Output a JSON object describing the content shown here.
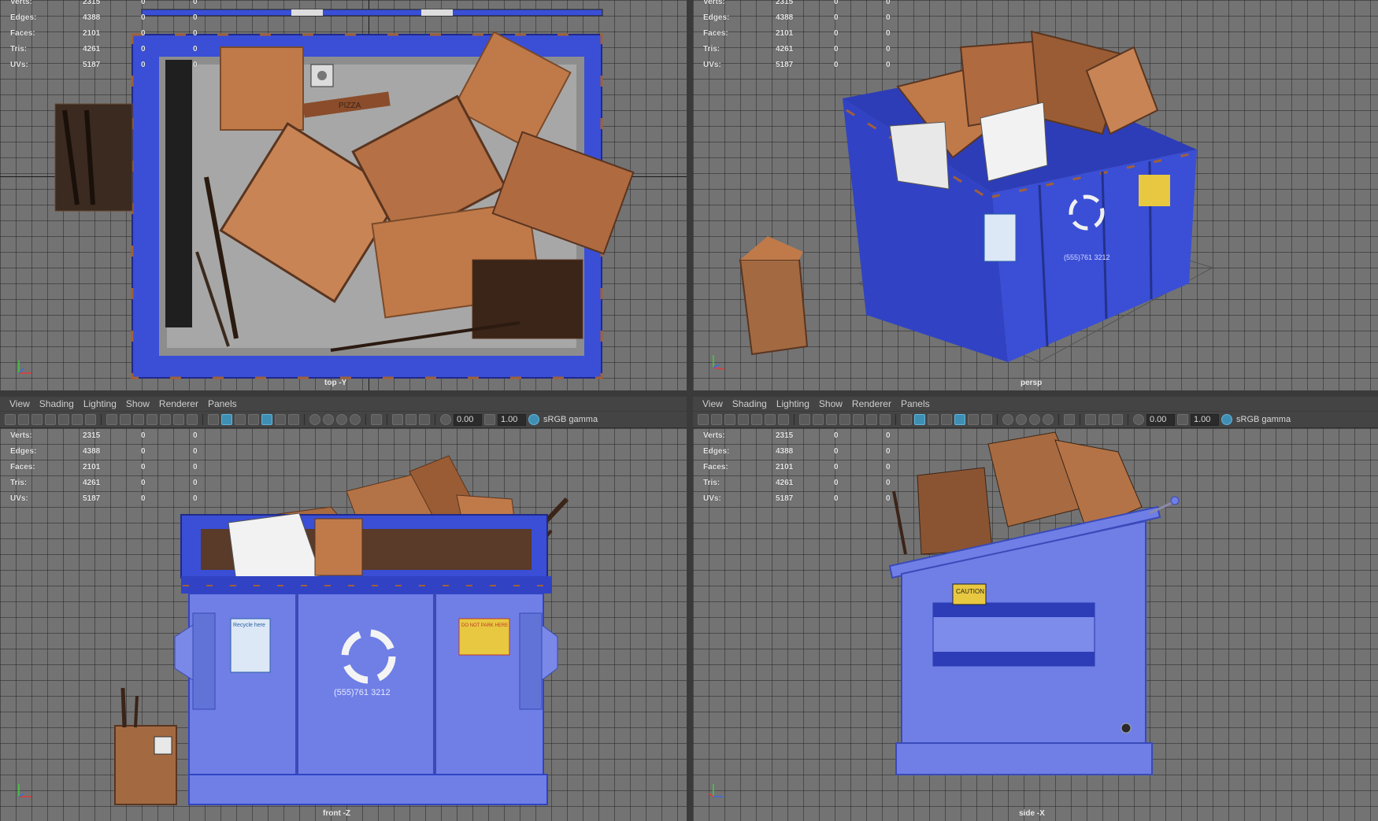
{
  "menu": [
    "View",
    "Shading",
    "Lighting",
    "Show",
    "Renderer",
    "Panels"
  ],
  "toolbar": {
    "field1": "0.00",
    "field2": "1.00",
    "color_space": "sRGB gamma"
  },
  "hud": {
    "rows": [
      {
        "label": "Verts:",
        "v1": "2315",
        "v2": "0",
        "v3": "0"
      },
      {
        "label": "Edges:",
        "v1": "4388",
        "v2": "0",
        "v3": "0"
      },
      {
        "label": "Faces:",
        "v1": "2101",
        "v2": "0",
        "v3": "0"
      },
      {
        "label": "Tris:",
        "v1": "4261",
        "v2": "0",
        "v3": "0"
      },
      {
        "label": "UVs:",
        "v1": "5187",
        "v2": "0",
        "v3": "0"
      }
    ]
  },
  "viewports": {
    "top": {
      "camera": "top -Y"
    },
    "persp": {
      "camera": "persp"
    },
    "front": {
      "camera": "front -Z"
    },
    "side": {
      "camera": "side -X"
    }
  },
  "decals": {
    "recycle_here": "Recycle here",
    "phone": "(555)761 3212",
    "no_park": "DO NOT PARK HERE",
    "caution": "CAUTION",
    "pizza": "PIZZA"
  },
  "colors": {
    "dumpster_blue": "#3a4fd6",
    "dumpster_light": "#6f7fe6",
    "cardboard": "#c07a4a",
    "cardboard_dark": "#7a4a2a",
    "rust": "#a0603a",
    "grid_bg": "#737373"
  },
  "icons": [
    "camera-icon",
    "bookmark-icon",
    "grid-icon",
    "wireframe-icon",
    "smooth-shade-icon",
    "textured-icon",
    "light-icon",
    "shadow-icon",
    "xray-icon",
    "isolate-icon",
    "exposure-icon",
    "gamma-icon",
    "color-management-icon"
  ]
}
